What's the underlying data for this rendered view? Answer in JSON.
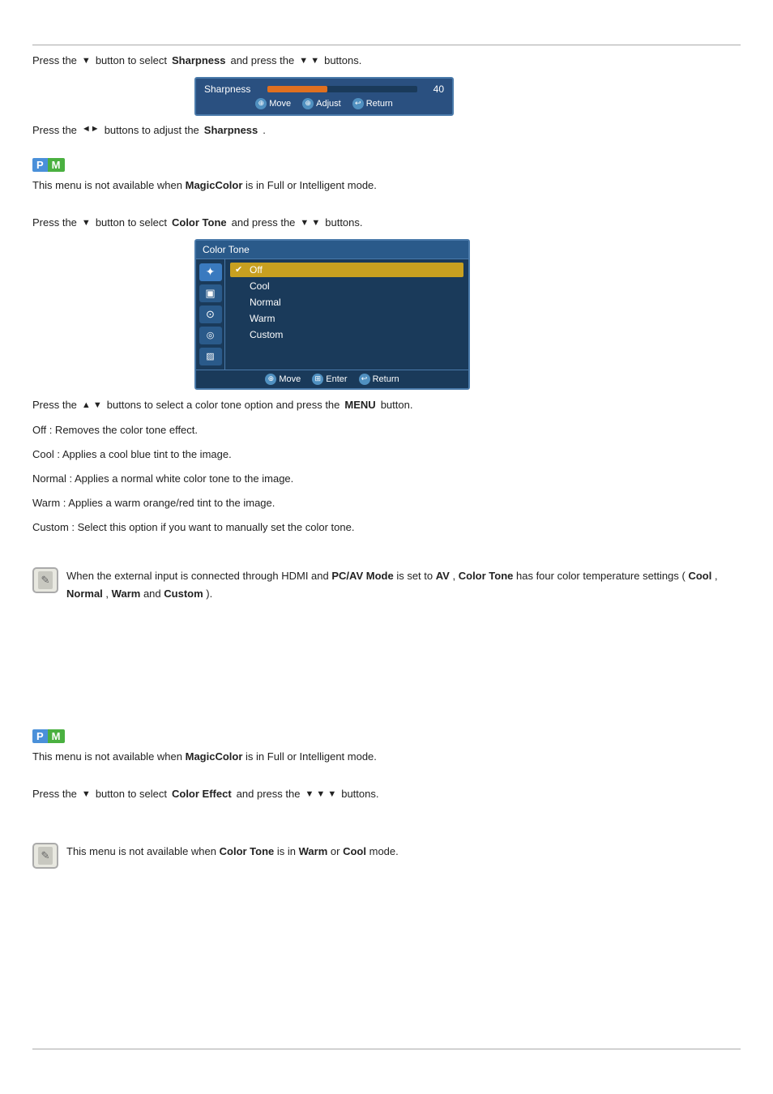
{
  "top_rule": true,
  "bottom_rule": true,
  "section1": {
    "line1_part1": "Press the",
    "line1_arrow": "▼",
    "line1_part2": "button to select",
    "line1_bold": "Sharpness",
    "line1_part3": "and press the",
    "line1_arrows2": "▼ ▼",
    "line1_part4": "buttons.",
    "osd": {
      "label": "Sharpness",
      "value": "40",
      "slider_percent": 40,
      "controls": [
        {
          "icon": "⊕",
          "label": "Move"
        },
        {
          "icon": "⊕",
          "label": "Adjust"
        },
        {
          "icon": "↩",
          "label": "Return"
        }
      ]
    }
  },
  "section2": {
    "line1_part1": "Press the",
    "line1_arrows": "◄►",
    "line1_part2": "buttons to adjust the",
    "line1_bold": "Sharpness",
    "line1_part3": ".",
    "pm_p": "P",
    "pm_m": "M",
    "pm_description": "This menu is not available when",
    "pm_bold": "MagicColor",
    "pm_end": "is in Full or Intelligent mode."
  },
  "section3": {
    "line1_part1": "Press the",
    "line1_arrow": "▼",
    "line1_part2": "button to select",
    "line1_bold": "Color Tone",
    "line1_part3": "and press the",
    "line1_arrows2": "▼ ▼",
    "line1_part4": "buttons.",
    "osd": {
      "header": "Color Tone",
      "icons": [
        "✦",
        "▣",
        "⊙",
        "◎",
        "▨"
      ],
      "options": [
        {
          "label": "Off",
          "selected": true,
          "checked": true
        },
        {
          "label": "Cool",
          "selected": false,
          "checked": false
        },
        {
          "label": "Normal",
          "selected": false,
          "checked": false
        },
        {
          "label": "Warm",
          "selected": false,
          "checked": false
        },
        {
          "label": "Custom",
          "selected": false,
          "checked": false
        }
      ],
      "controls": [
        {
          "icon": "⊕",
          "label": "Move"
        },
        {
          "icon": "⊞",
          "label": "Enter"
        },
        {
          "icon": "↩",
          "label": "Return"
        }
      ]
    }
  },
  "section4": {
    "line1_part1": "Press the",
    "line1_arrows": "▲ ▼",
    "line1_part2": "buttons to select a color tone option and press the",
    "line1_bold": "MENU",
    "line1_part3": "button.",
    "line2": "Off : Removes the color tone effect.",
    "line3": "Cool : Applies a cool blue tint to the image.",
    "line4": "Normal : Applies a normal white color tone to the image.",
    "line5": "Warm : Applies a warm orange/red tint to the image.",
    "line6": "Custom : Select this option if you want to manually set the color tone."
  },
  "section5": {
    "note_text1": "When the external input is connected through HDMI and",
    "note_bold1": "PC/AV Mode",
    "note_text2": "is set to",
    "note_bold2": "AV",
    "note_text3": ",",
    "note_text4": "Color Tone",
    "note_text5": "has four color temperature settings (",
    "note_bold3": "Cool",
    "note_text6": ",",
    "note_bold4": "Normal",
    "note_text7": ",",
    "note_bold5": "Warm",
    "note_text8": " and",
    "note_bold6": "Custom",
    "note_text9": ")."
  },
  "section6": {
    "pm_p": "P",
    "pm_m": "M",
    "pm_description": "This menu is not available when",
    "pm_bold": "MagicColor",
    "pm_end": "is in Full or Intelligent mode."
  },
  "section7": {
    "line1_part1": "Press the",
    "line1_arrow": "▼",
    "line1_part2": "button to select",
    "line1_bold1": "Color Effect",
    "line1_part3": "and press the",
    "line1_arrows": "▼ ▼ ▼",
    "line1_part4": "buttons."
  },
  "section8": {
    "note_text": "This menu is not available when",
    "note_bold1": "Color Tone",
    "note_text2": "is in",
    "note_bold2": "Warm",
    "note_text3": "or",
    "note_bold3": "Cool",
    "note_text4": "mode."
  }
}
